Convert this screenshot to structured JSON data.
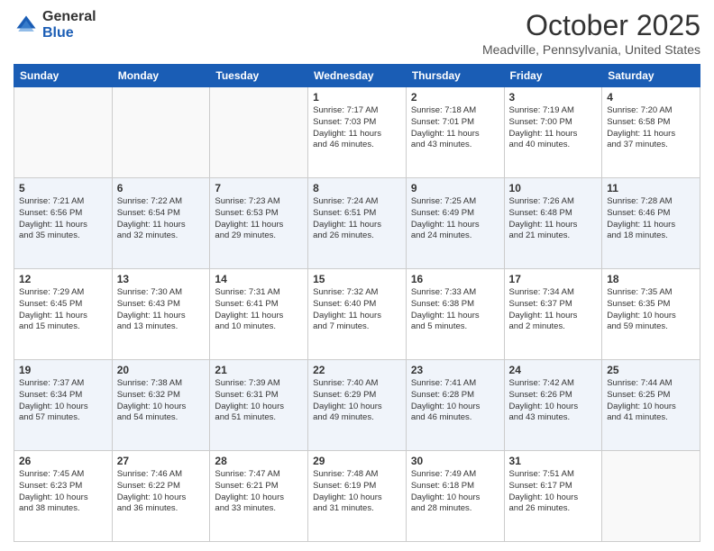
{
  "header": {
    "logo_general": "General",
    "logo_blue": "Blue",
    "month_title": "October 2025",
    "location": "Meadville, Pennsylvania, United States"
  },
  "weekdays": [
    "Sunday",
    "Monday",
    "Tuesday",
    "Wednesday",
    "Thursday",
    "Friday",
    "Saturday"
  ],
  "weeks": [
    [
      {
        "day": "",
        "info": ""
      },
      {
        "day": "",
        "info": ""
      },
      {
        "day": "",
        "info": ""
      },
      {
        "day": "1",
        "info": "Sunrise: 7:17 AM\nSunset: 7:03 PM\nDaylight: 11 hours\nand 46 minutes."
      },
      {
        "day": "2",
        "info": "Sunrise: 7:18 AM\nSunset: 7:01 PM\nDaylight: 11 hours\nand 43 minutes."
      },
      {
        "day": "3",
        "info": "Sunrise: 7:19 AM\nSunset: 7:00 PM\nDaylight: 11 hours\nand 40 minutes."
      },
      {
        "day": "4",
        "info": "Sunrise: 7:20 AM\nSunset: 6:58 PM\nDaylight: 11 hours\nand 37 minutes."
      }
    ],
    [
      {
        "day": "5",
        "info": "Sunrise: 7:21 AM\nSunset: 6:56 PM\nDaylight: 11 hours\nand 35 minutes."
      },
      {
        "day": "6",
        "info": "Sunrise: 7:22 AM\nSunset: 6:54 PM\nDaylight: 11 hours\nand 32 minutes."
      },
      {
        "day": "7",
        "info": "Sunrise: 7:23 AM\nSunset: 6:53 PM\nDaylight: 11 hours\nand 29 minutes."
      },
      {
        "day": "8",
        "info": "Sunrise: 7:24 AM\nSunset: 6:51 PM\nDaylight: 11 hours\nand 26 minutes."
      },
      {
        "day": "9",
        "info": "Sunrise: 7:25 AM\nSunset: 6:49 PM\nDaylight: 11 hours\nand 24 minutes."
      },
      {
        "day": "10",
        "info": "Sunrise: 7:26 AM\nSunset: 6:48 PM\nDaylight: 11 hours\nand 21 minutes."
      },
      {
        "day": "11",
        "info": "Sunrise: 7:28 AM\nSunset: 6:46 PM\nDaylight: 11 hours\nand 18 minutes."
      }
    ],
    [
      {
        "day": "12",
        "info": "Sunrise: 7:29 AM\nSunset: 6:45 PM\nDaylight: 11 hours\nand 15 minutes."
      },
      {
        "day": "13",
        "info": "Sunrise: 7:30 AM\nSunset: 6:43 PM\nDaylight: 11 hours\nand 13 minutes."
      },
      {
        "day": "14",
        "info": "Sunrise: 7:31 AM\nSunset: 6:41 PM\nDaylight: 11 hours\nand 10 minutes."
      },
      {
        "day": "15",
        "info": "Sunrise: 7:32 AM\nSunset: 6:40 PM\nDaylight: 11 hours\nand 7 minutes."
      },
      {
        "day": "16",
        "info": "Sunrise: 7:33 AM\nSunset: 6:38 PM\nDaylight: 11 hours\nand 5 minutes."
      },
      {
        "day": "17",
        "info": "Sunrise: 7:34 AM\nSunset: 6:37 PM\nDaylight: 11 hours\nand 2 minutes."
      },
      {
        "day": "18",
        "info": "Sunrise: 7:35 AM\nSunset: 6:35 PM\nDaylight: 10 hours\nand 59 minutes."
      }
    ],
    [
      {
        "day": "19",
        "info": "Sunrise: 7:37 AM\nSunset: 6:34 PM\nDaylight: 10 hours\nand 57 minutes."
      },
      {
        "day": "20",
        "info": "Sunrise: 7:38 AM\nSunset: 6:32 PM\nDaylight: 10 hours\nand 54 minutes."
      },
      {
        "day": "21",
        "info": "Sunrise: 7:39 AM\nSunset: 6:31 PM\nDaylight: 10 hours\nand 51 minutes."
      },
      {
        "day": "22",
        "info": "Sunrise: 7:40 AM\nSunset: 6:29 PM\nDaylight: 10 hours\nand 49 minutes."
      },
      {
        "day": "23",
        "info": "Sunrise: 7:41 AM\nSunset: 6:28 PM\nDaylight: 10 hours\nand 46 minutes."
      },
      {
        "day": "24",
        "info": "Sunrise: 7:42 AM\nSunset: 6:26 PM\nDaylight: 10 hours\nand 43 minutes."
      },
      {
        "day": "25",
        "info": "Sunrise: 7:44 AM\nSunset: 6:25 PM\nDaylight: 10 hours\nand 41 minutes."
      }
    ],
    [
      {
        "day": "26",
        "info": "Sunrise: 7:45 AM\nSunset: 6:23 PM\nDaylight: 10 hours\nand 38 minutes."
      },
      {
        "day": "27",
        "info": "Sunrise: 7:46 AM\nSunset: 6:22 PM\nDaylight: 10 hours\nand 36 minutes."
      },
      {
        "day": "28",
        "info": "Sunrise: 7:47 AM\nSunset: 6:21 PM\nDaylight: 10 hours\nand 33 minutes."
      },
      {
        "day": "29",
        "info": "Sunrise: 7:48 AM\nSunset: 6:19 PM\nDaylight: 10 hours\nand 31 minutes."
      },
      {
        "day": "30",
        "info": "Sunrise: 7:49 AM\nSunset: 6:18 PM\nDaylight: 10 hours\nand 28 minutes."
      },
      {
        "day": "31",
        "info": "Sunrise: 7:51 AM\nSunset: 6:17 PM\nDaylight: 10 hours\nand 26 minutes."
      },
      {
        "day": "",
        "info": ""
      }
    ]
  ]
}
